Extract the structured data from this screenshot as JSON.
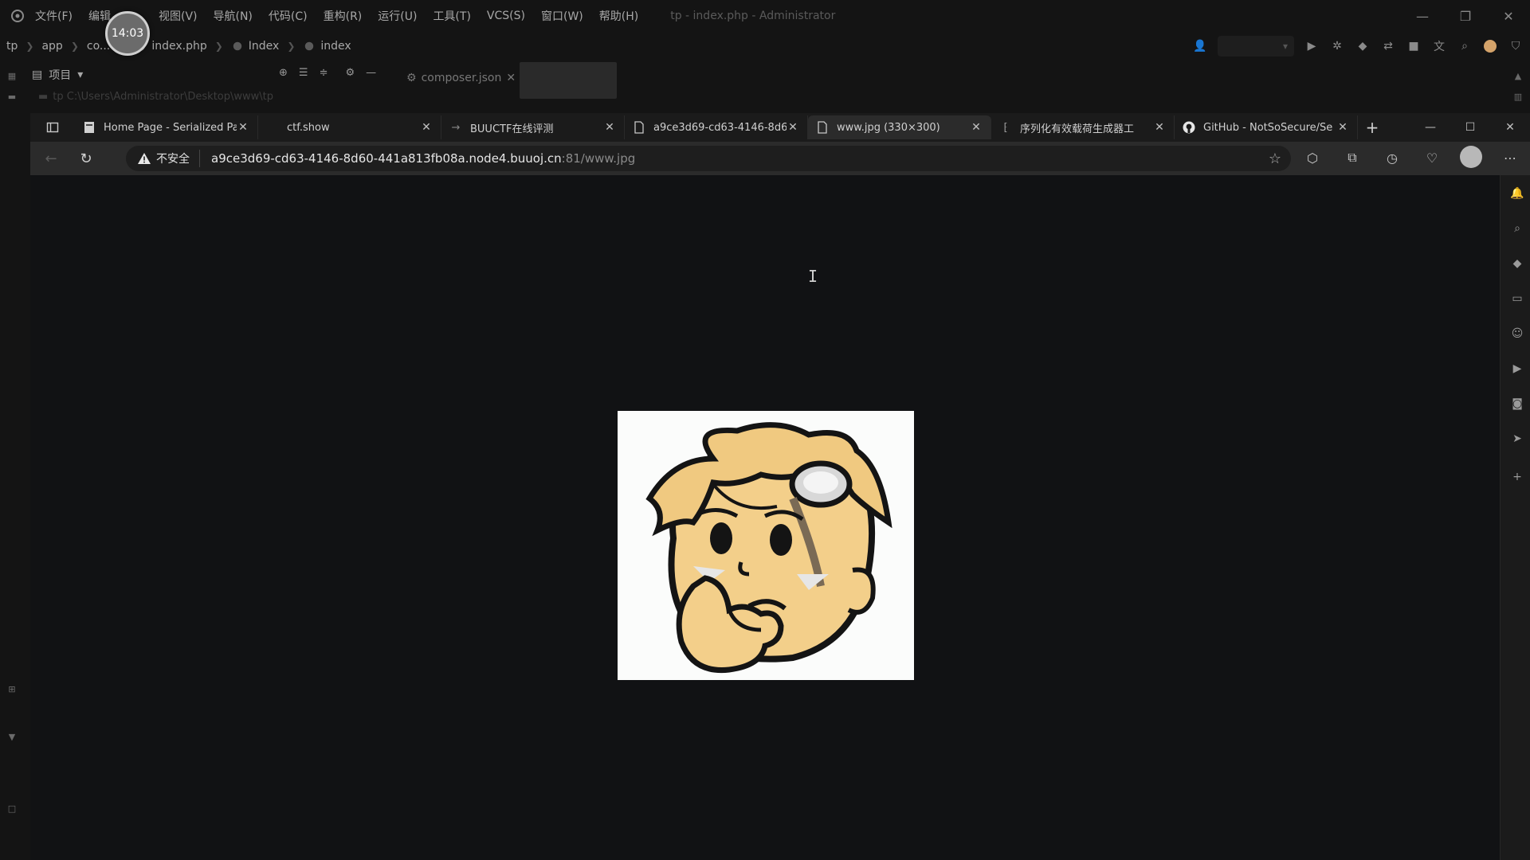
{
  "ide": {
    "menu": [
      "文件(F)",
      "编辑",
      "视图(V)",
      "导航(N)",
      "代码(C)",
      "重构(R)",
      "运行(U)",
      "工具(T)",
      "VCS(S)",
      "窗口(W)",
      "帮助(H)"
    ],
    "title": "tp - index.php - Administrator",
    "clock": "14:03",
    "breadcrumb": {
      "root": "tp",
      "app": "app",
      "controller": "co...",
      "file": "index.php",
      "class": "Index",
      "method": "index"
    },
    "project_label": "项目",
    "project_path": "tp  C:\\Users\\Administrator\\Desktop\\www\\tp",
    "editor_tab": "composer.json"
  },
  "browser": {
    "tabs": [
      {
        "title": "Home Page - Serialized Pa",
        "icon": "page-icon",
        "active": false
      },
      {
        "title": "ctf.show",
        "icon": "none",
        "active": false
      },
      {
        "title": "BUUCTF在线评测",
        "icon": "arrow-icon",
        "active": false
      },
      {
        "title": "a9ce3d69-cd63-4146-8d6",
        "icon": "document-icon",
        "active": false
      },
      {
        "title": "www.jpg (330×300)",
        "icon": "document-icon",
        "active": true
      },
      {
        "title": "序列化有效载荷生成器工",
        "icon": "tool-icon",
        "active": false
      },
      {
        "title": "GitHub - NotSoSecure/Se",
        "icon": "github-icon",
        "active": false
      }
    ],
    "security_label": "不安全",
    "url_host": "a9ce3d69-cd63-4146-8d60-441a813fb08a.node4.buuoj.cn",
    "url_rest": ":81/www.jpg"
  },
  "colors": {
    "background": "#111214",
    "chrome": "#2b2b2b",
    "tabstrip": "#1b1b1b",
    "skin": "#f3cf8a",
    "hair": "#f0c980"
  }
}
